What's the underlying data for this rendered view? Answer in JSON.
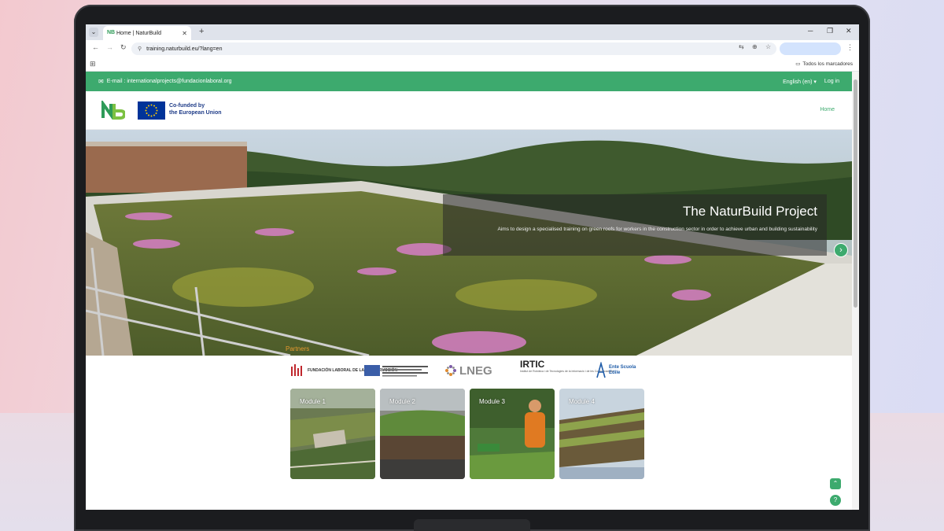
{
  "browser": {
    "tab_title": "Home | NaturBuild",
    "tab_favicon": "NB",
    "url": "training.naturbuild.eu/?lang=en",
    "bookmarks_folder": "Todos los marcadores"
  },
  "site": {
    "email_text": "E-mail : internationalprojects@fundacionlaboral.org",
    "language": "English (en) ▾",
    "login": "Log in",
    "eu_line1": "Co-funded by",
    "eu_line2": "the European Union",
    "nav_home": "Home",
    "hero_title": "The NaturBuild Project",
    "hero_subtitle": "Aims to design a specialised training on green roofs for workers in the construction sector in order to achieve urban and building sustainability",
    "partners_title": "Partners",
    "partners": [
      {
        "name": "FUNDACIÓN LABORAL DE LA CONSTRUCCIÓN"
      },
      {
        "name": "LNEG"
      },
      {
        "name": "IRTIC",
        "sub": "Institut de Robòtica i de Tecnologies de la Informació i de les Comunicacions"
      },
      {
        "name": "Ente Scuola Edile"
      }
    ],
    "modules": [
      "Module 1",
      "Module 2",
      "Module 3",
      "Module 4"
    ]
  },
  "colors": {
    "brand_green": "#3daa6e",
    "partners_orange": "#e69a2e",
    "eu_blue": "#003399"
  }
}
